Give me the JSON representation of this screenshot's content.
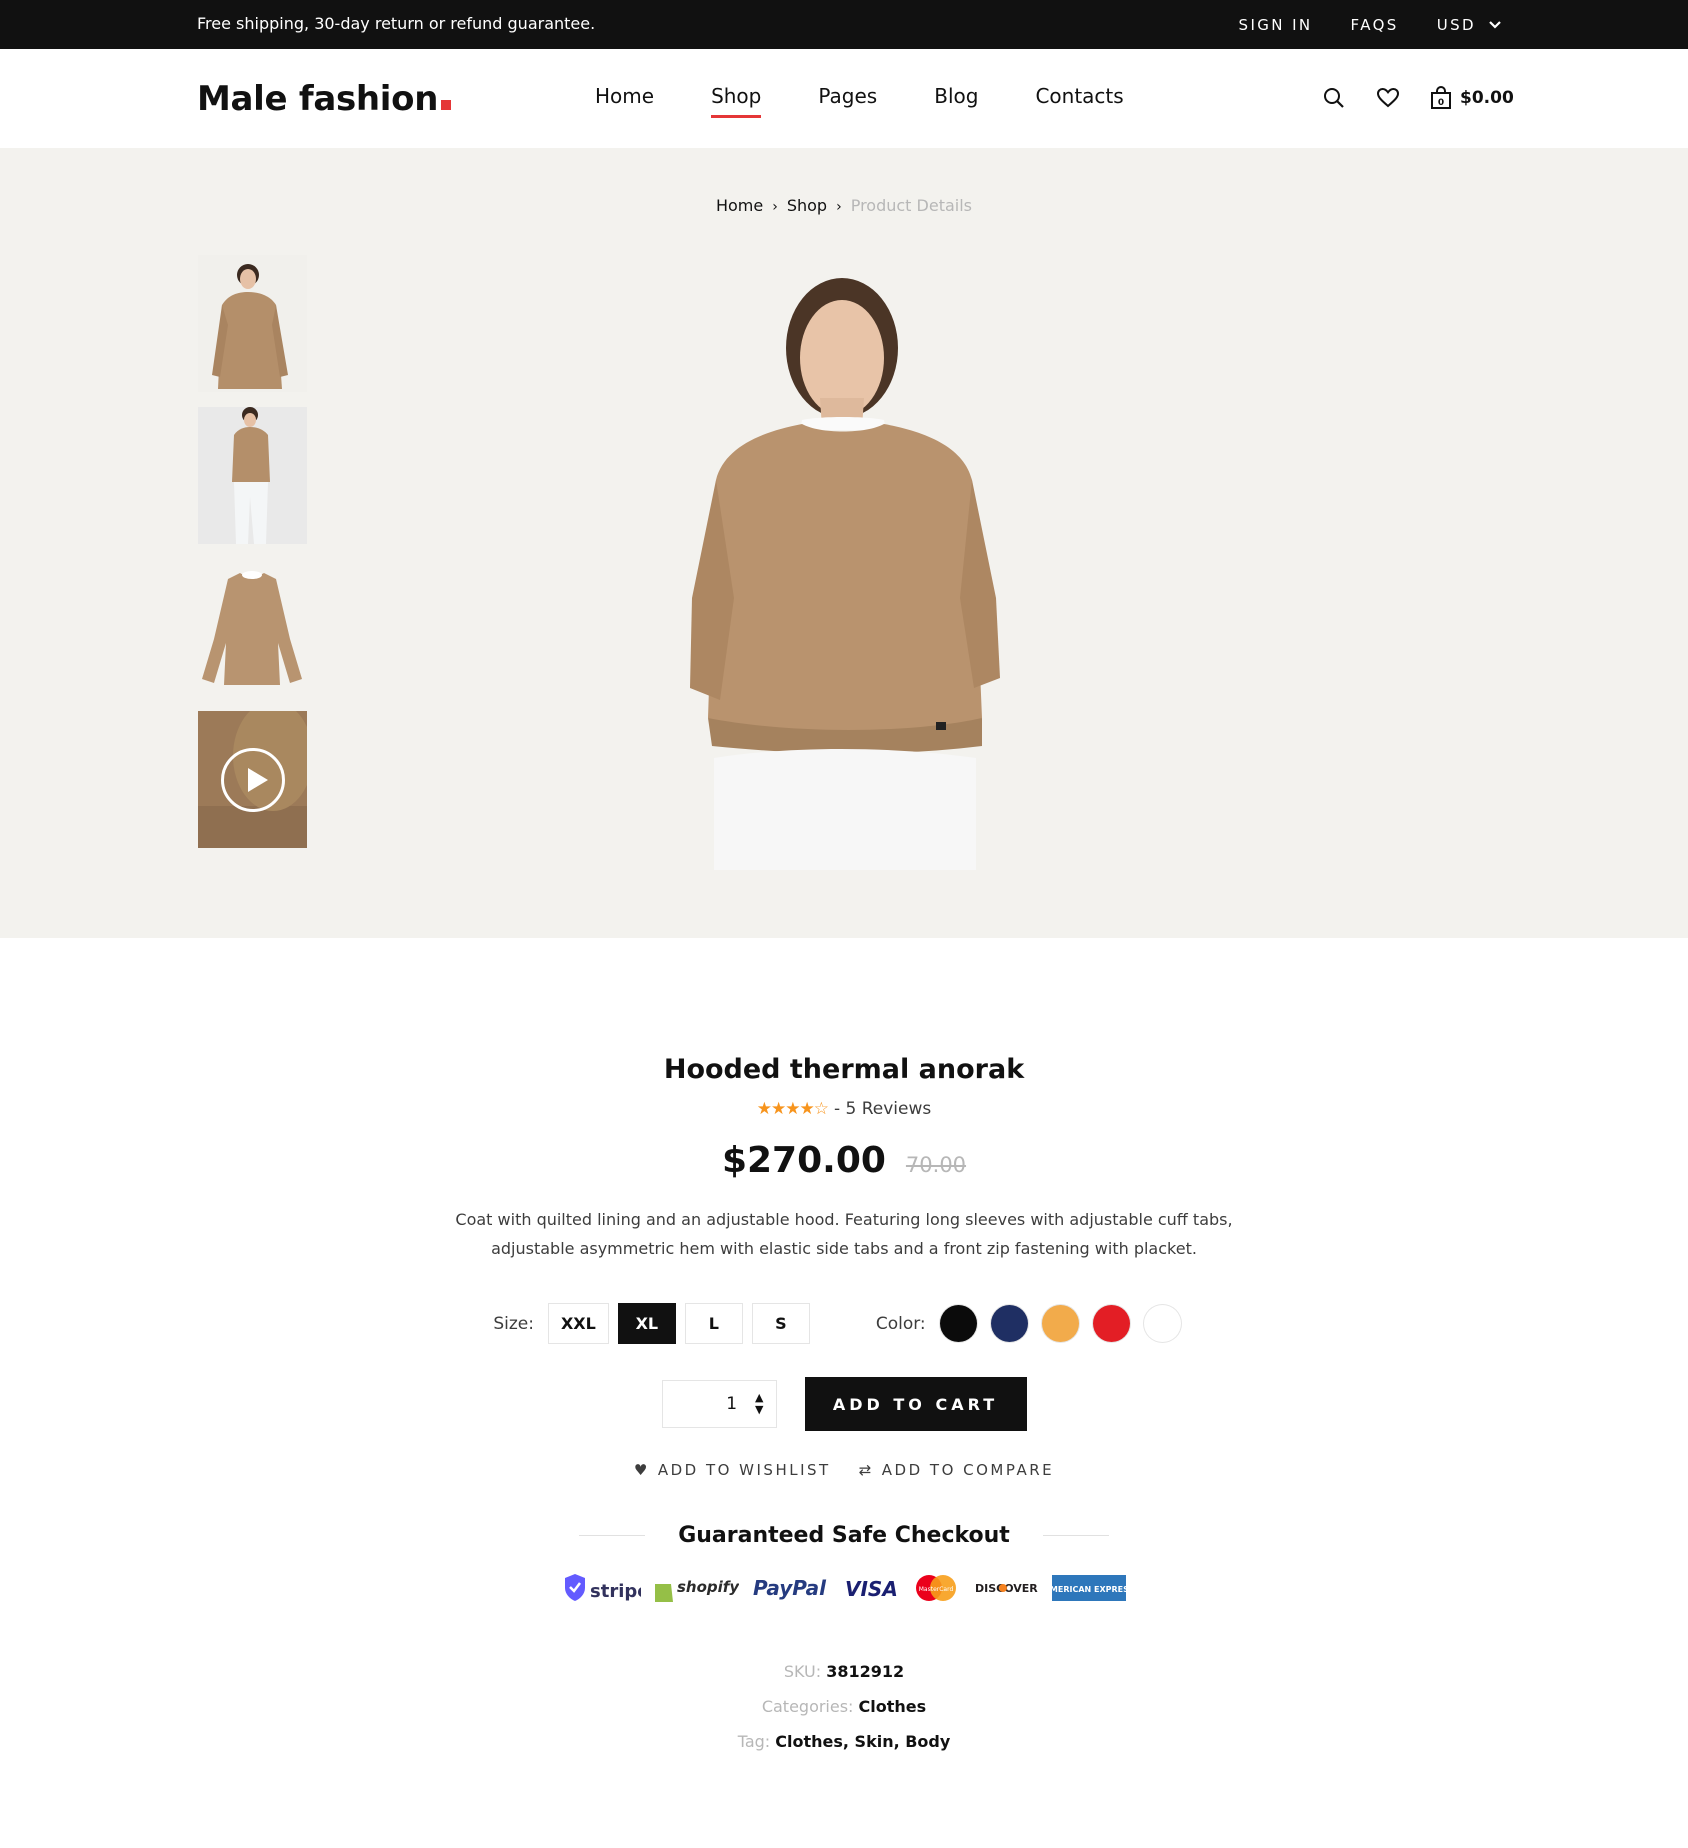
{
  "topbar": {
    "promo": "Free shipping, 30-day return or refund guarantee.",
    "sign_in": "SIGN IN",
    "faqs": "FAQS",
    "currency": "USD"
  },
  "header": {
    "logo": "Male fashion",
    "nav": [
      "Home",
      "Shop",
      "Pages",
      "Blog",
      "Contacts"
    ],
    "active_nav": "Shop",
    "cart_count": "0",
    "cart_total": "$0.00"
  },
  "breadcrumb": {
    "items": [
      "Home",
      "Shop"
    ],
    "current": "Product Details"
  },
  "product": {
    "title": "Hooded thermal anorak",
    "rating": 4,
    "rating_max": 5,
    "reviews": "- 5 Reviews",
    "price": "$270.00",
    "old_price": "70.00",
    "description": "Coat with quilted lining and an adjustable hood. Featuring long sleeves with adjustable cuff tabs, adjustable asymmetric hem with elastic side tabs and a front zip fastening with placket.",
    "size_label": "Size:",
    "sizes": [
      "XXL",
      "XL",
      "L",
      "S"
    ],
    "selected_size": "XL",
    "color_label": "Color:",
    "colors": [
      "#0b0b0b",
      "#1f2f63",
      "#f2ab4b",
      "#e31e25",
      "#ffffff"
    ],
    "quantity": "1",
    "add_to_cart": "ADD TO CART",
    "add_to_wishlist": "ADD TO WISHLIST",
    "add_to_compare": "ADD TO COMPARE"
  },
  "checkout": {
    "title": "Guaranteed Safe Checkout",
    "methods": [
      "stripe",
      "shopify",
      "PayPal",
      "VISA",
      "MasterCard",
      "DISCOVER",
      "AMERICAN EXPRESS"
    ]
  },
  "meta": {
    "sku_label": "SKU:",
    "sku": "3812912",
    "categories_label": "Categories:",
    "categories": "Clothes",
    "tag_label": "Tag:",
    "tags": "Clothes, Skin, Body"
  },
  "colors": {
    "accent": "#e53637",
    "dark": "#111111",
    "hero_bg": "#f3f2ee",
    "star": "#f7941d"
  },
  "icons": [
    "search-icon",
    "heart-icon",
    "shopping-bag-icon",
    "chevron-down-icon",
    "play-icon",
    "heart-filled-icon",
    "compare-arrows-icon"
  ]
}
